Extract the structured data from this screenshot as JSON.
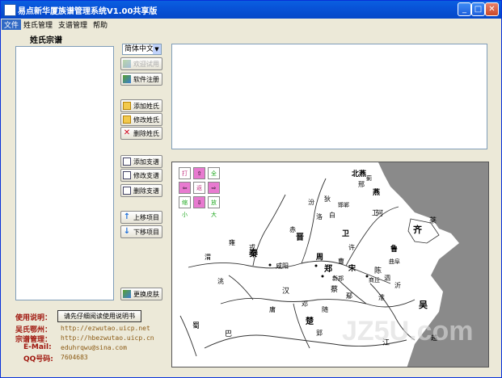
{
  "window": {
    "title": "易点新华厦族谱管理系统V1.00共享版"
  },
  "menu": {
    "items": [
      "文件",
      "姓氏管理",
      "支谱管理",
      "帮助"
    ]
  },
  "left_panel": {
    "title": "姓氏宗谱"
  },
  "language": {
    "selected": "简体中文"
  },
  "buttons": {
    "trial": "欢迎试用",
    "register": "软件注册",
    "add_surname": "添加姓氏",
    "edit_surname": "修改姓氏",
    "delete_surname": "删除姓氏",
    "add_branch": "添加支谱",
    "edit_branch": "修改支谱",
    "delete_branch": "删除支谱",
    "move_up": "上移项目",
    "move_down": "下移项目",
    "change_skin": "更换皮肤",
    "manual": "请先仔细阅读使用说明书"
  },
  "map_controls": {
    "open": "打开",
    "up": "⇧",
    "fullscreen": "全屏",
    "left": "⇦",
    "back": "返回",
    "right": "⇨",
    "shrink": "缩小",
    "down": "⇩",
    "enlarge": "放大"
  },
  "info": {
    "usage_label": "使用说明：",
    "site1_label": "吴氏鄂州：",
    "site1_value": "http://ezwutao.uicp.net",
    "site2_label": "宗谱管理：",
    "site2_value": "http://hbezwutao.uicp.cn",
    "email_label": "E-Mail:",
    "email_value": "eduhrqwu@sina.com",
    "qq_label": "QQ号码:",
    "qq_value": "7604683"
  },
  "map_labels": [
    "北燕",
    "蓟",
    "燕",
    "秦",
    "晋",
    "卫",
    "曹",
    "宋",
    "鲁",
    "齐",
    "莱",
    "周",
    "郑",
    "楚",
    "吴",
    "巴",
    "蜀",
    "蔡",
    "陈",
    "许",
    "雍",
    "咸阳",
    "新郑",
    "商丘",
    "曲阜",
    "江",
    "汉",
    "河",
    "渭",
    "洛",
    "淮",
    "洮",
    "汾",
    "泗",
    "沂",
    "狄",
    "白",
    "赤",
    "戎",
    "邢",
    "卫",
    "郢",
    "越",
    "邯郸",
    "鄢",
    "邓",
    "随",
    "庸"
  ],
  "watermark": "JZ5U.com"
}
